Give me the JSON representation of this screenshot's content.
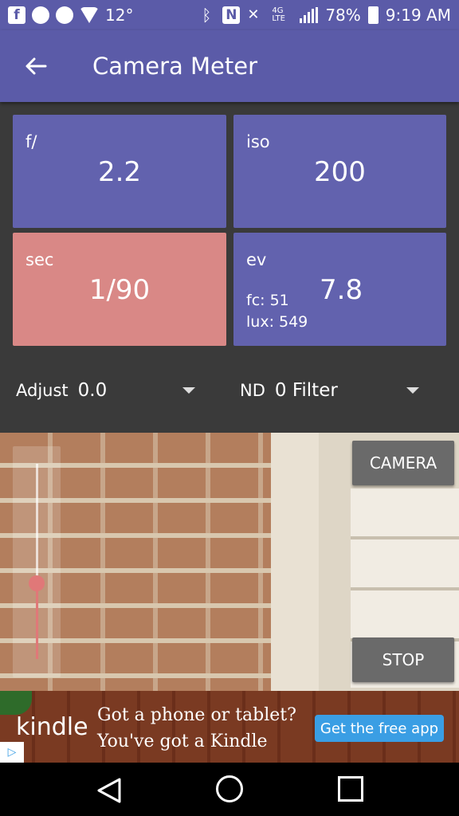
{
  "status_bar": {
    "temperature": "12°",
    "battery": "78%",
    "time": "9:19 AM",
    "network": "4G LTE",
    "icons": [
      "facebook-icon",
      "whatsapp-icon",
      "aperture-icon",
      "wifi-icon",
      "bluetooth-icon",
      "nfc-icon",
      "mute-icon",
      "signal-icon",
      "battery-icon"
    ]
  },
  "app_bar": {
    "title": "Camera Meter",
    "back_icon": "arrow-left-icon"
  },
  "meter": {
    "aperture": {
      "label": "f/",
      "value": "2.2"
    },
    "iso": {
      "label": "iso",
      "value": "200"
    },
    "shutter": {
      "label": "sec",
      "value": "1/90"
    },
    "ev": {
      "label": "ev",
      "value": "7.8",
      "fc": "fc: 51",
      "lux": "lux: 549"
    }
  },
  "controls": {
    "adjust_label": "Adjust",
    "adjust_value": "0.0",
    "nd_label": "ND",
    "nd_value": "0 Filter"
  },
  "preview": {
    "camera_button": "CAMERA",
    "stop_button": "STOP"
  },
  "ad": {
    "brand": "kindle",
    "headline_1": "Got a phone or tablet?",
    "headline_2": "You've got a Kindle",
    "cta": "Get the free app"
  },
  "colors": {
    "primary": "#5b5ba8",
    "tile_blue": "#6262ae",
    "tile_pink": "#d98886",
    "accent": "#e07878",
    "background": "#3a3a3a"
  }
}
